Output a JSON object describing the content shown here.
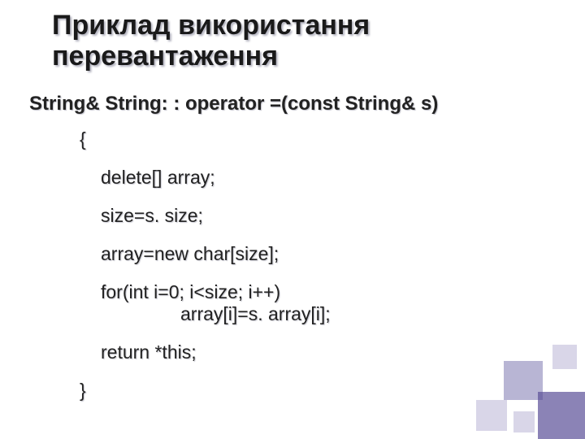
{
  "title_line1": "Приклад використання",
  "title_line2": "перевантаження",
  "signature": "String& String: : operator =(const String& s)",
  "code": {
    "open": "{",
    "l1": "delete[] array;",
    "l2": "size=s. size;",
    "l3": "array=new char[size];",
    "l4a": "for(int i=0; i<size; i++)",
    "l4b": "array[i]=s. array[i];",
    "l5": "return *this;",
    "close": "}"
  }
}
